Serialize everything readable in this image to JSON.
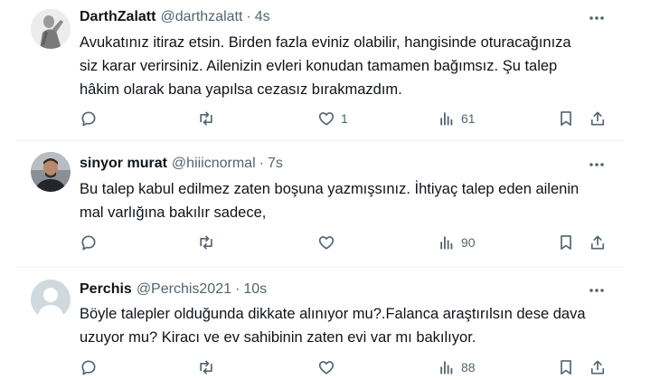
{
  "colors": {
    "text": "#0f1419",
    "secondary": "#536471",
    "divider": "#eff3f4"
  },
  "tweets": [
    {
      "name": "DarthZalatt",
      "handle": "@darthzalatt",
      "separator": "·",
      "time": "4s",
      "avatar": "statue-avatar",
      "lines": [
        "Avukatınız itiraz etsin. Birden fazla eviniz olabilir, hangisinde oturacağınıza",
        "siz karar verirsiniz. Ailenizin evleri konudan tamamen bağımsız. Şu talep",
        "hâkim olarak bana yapılsa cezasız bırakmazdım."
      ],
      "reply_count": "",
      "retweet_count": "",
      "like_count": "1",
      "view_count": "61"
    },
    {
      "name": "sinyor murat",
      "handle": "@hiiicnormal",
      "separator": "·",
      "time": "7s",
      "avatar": "photo-avatar",
      "lines": [
        "Bu talep kabul edilmez zaten boşuna yazmışsınız. İhtiyaç talep eden ailenin",
        "mal varlığına bakılır sadece,"
      ],
      "reply_count": "",
      "retweet_count": "",
      "like_count": "",
      "view_count": "90"
    },
    {
      "name": "Perchis",
      "handle": "@Perchis2021",
      "separator": "·",
      "time": "10s",
      "avatar": "default-avatar",
      "lines": [
        "Böyle talepler olduğunda dikkate alınıyor mu?.Falanca araştırılsın dese dava",
        "uzuyor mu? Kiracı ve ev sahibinin zaten evi var mı bakılıyor."
      ],
      "reply_count": "",
      "retweet_count": "",
      "like_count": "",
      "view_count": "88"
    }
  ]
}
